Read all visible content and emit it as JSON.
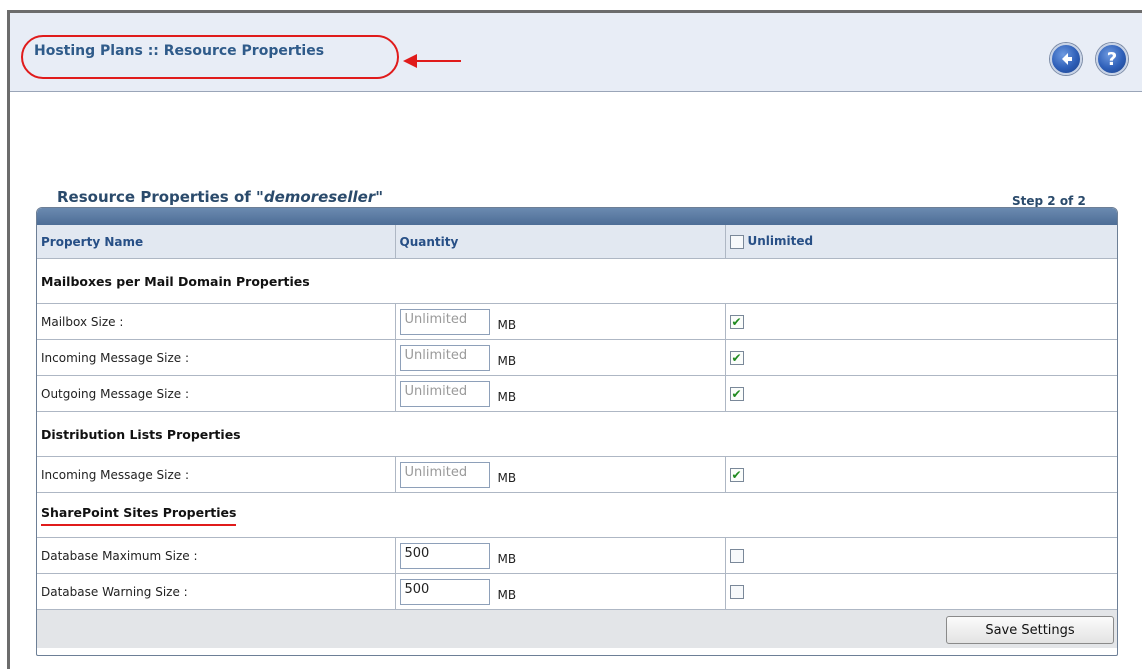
{
  "header": {
    "title": "Hosting Plans :: Resource Properties",
    "back_icon": "back-arrow-icon",
    "help_icon": "help-icon",
    "help_glyph": "?"
  },
  "section": {
    "title_prefix": "Resource Properties of ",
    "title_name": "\"demoreseller\"",
    "step": "Step 2 of 2"
  },
  "table": {
    "columns": [
      "Property Name",
      "Quantity",
      "Unlimited"
    ],
    "groups": [
      {
        "name": "Mailboxes per Mail Domain Properties",
        "rows": [
          {
            "label": "Mailbox Size :",
            "value": "Unlimited",
            "unit": "MB",
            "unlimited": true
          },
          {
            "label": "Incoming Message Size :",
            "value": "Unlimited",
            "unit": "MB",
            "unlimited": true
          },
          {
            "label": "Outgoing Message Size :",
            "value": "Unlimited",
            "unit": "MB",
            "unlimited": true
          }
        ]
      },
      {
        "name": "Distribution Lists Properties",
        "rows": [
          {
            "label": "Incoming Message Size :",
            "value": "Unlimited",
            "unit": "MB",
            "unlimited": true
          }
        ]
      },
      {
        "name": "SharePoint Sites Properties",
        "rows": [
          {
            "label": "Database Maximum Size :",
            "value": "500",
            "unit": "MB",
            "unlimited": false
          },
          {
            "label": "Database Warning Size :",
            "value": "500",
            "unit": "MB",
            "unlimited": false
          }
        ]
      }
    ]
  },
  "footer": {
    "save_label": "Save Settings"
  },
  "colors": {
    "accent": "#2f5b8a",
    "highlight": "#e01b1b",
    "check": "#1f8a1f"
  }
}
